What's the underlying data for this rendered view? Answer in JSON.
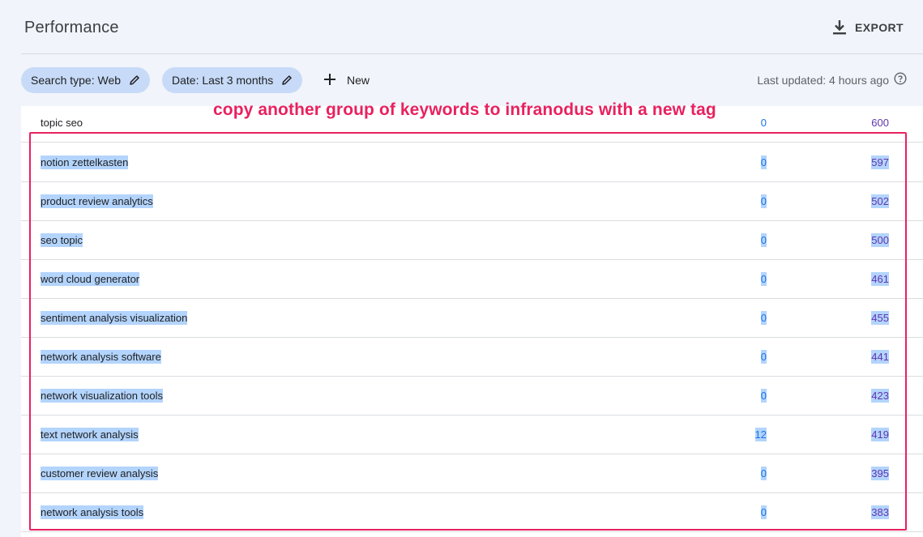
{
  "header": {
    "title": "Performance",
    "export_label": "EXPORT"
  },
  "filters": {
    "search_type": "Search type: Web",
    "date": "Date: Last 3 months",
    "new_label": "New",
    "last_updated": "Last updated: 4 hours ago"
  },
  "annotation": "copy another group of keywords to infranodus with a new tag",
  "rows": [
    {
      "keyword": "topic seo",
      "clicks": "0",
      "impressions": "600"
    },
    {
      "keyword": "notion zettelkasten",
      "clicks": "0",
      "impressions": "597"
    },
    {
      "keyword": "product review analytics",
      "clicks": "0",
      "impressions": "502"
    },
    {
      "keyword": "seo topic",
      "clicks": "0",
      "impressions": "500"
    },
    {
      "keyword": "word cloud generator",
      "clicks": "0",
      "impressions": "461"
    },
    {
      "keyword": "sentiment analysis visualization",
      "clicks": "0",
      "impressions": "455"
    },
    {
      "keyword": "network analysis software",
      "clicks": "0",
      "impressions": "441"
    },
    {
      "keyword": "network visualization tools",
      "clicks": "0",
      "impressions": "423"
    },
    {
      "keyword": "text network analysis",
      "clicks": "12",
      "impressions": "419"
    },
    {
      "keyword": "customer review analysis",
      "clicks": "0",
      "impressions": "395"
    },
    {
      "keyword": "network analysis tools",
      "clicks": "0",
      "impressions": "383"
    }
  ],
  "colors": {
    "accent_annotation": "#e8215f",
    "chip_bg": "#c7dbf8",
    "clicks_color": "#1a73e8",
    "impressions_color": "#5e35b1",
    "selection": "#b3d4fc"
  },
  "icons": {
    "export": "download-icon",
    "chip_edit": "pencil-icon",
    "new": "plus-icon",
    "help": "help-circle-icon"
  }
}
